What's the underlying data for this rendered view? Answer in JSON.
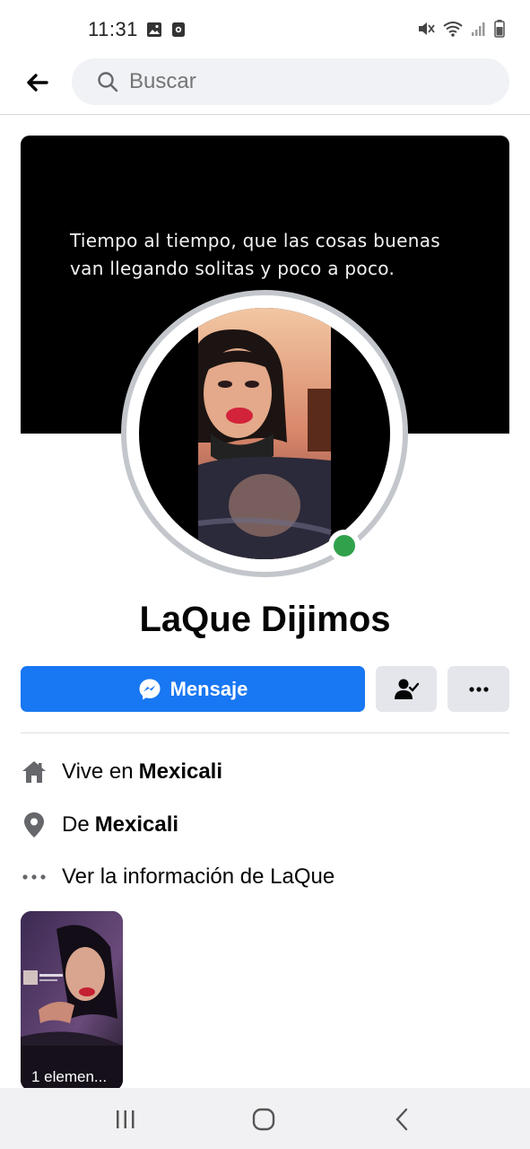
{
  "status_bar": {
    "time": "11:31"
  },
  "search": {
    "placeholder": "Buscar"
  },
  "cover": {
    "quote_line1": "Tiempo al tiempo, que las cosas buenas",
    "quote_line2": "van llegando solitas y poco a poco."
  },
  "profile": {
    "name": "LaQue Dijimos",
    "online": true,
    "accent_color": "#1877f2",
    "online_color": "#31a24c"
  },
  "actions": {
    "message_label": "Mensaje",
    "friend_icon": "friend-check-icon",
    "more_icon": "more-dots-icon"
  },
  "info": {
    "lives_prefix": "Vive en",
    "lives_city": "Mexicali",
    "from_prefix": "De",
    "from_city": "Mexicali",
    "see_info": "Ver la información de LaQue"
  },
  "featured": {
    "label": "1 elemen..."
  }
}
